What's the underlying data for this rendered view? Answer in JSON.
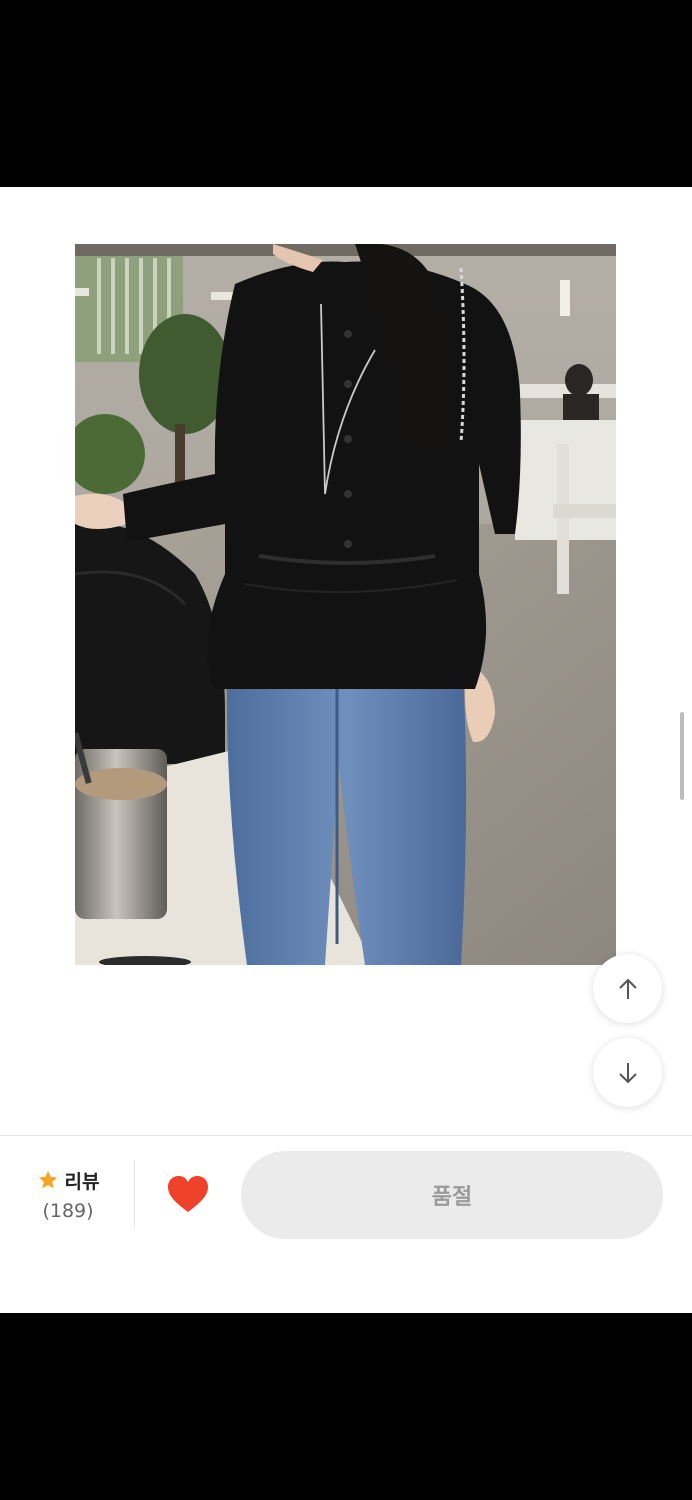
{
  "product_image": {
    "alt_icon": "product-photo"
  },
  "scroll": {
    "up_icon": "arrow-up-icon",
    "down_icon": "arrow-down-icon"
  },
  "bottom_bar": {
    "review_label": "리뷰",
    "review_count": "(189)",
    "star_color": "#f6a623",
    "heart_color": "#f0412b",
    "soldout_label": "품절"
  }
}
